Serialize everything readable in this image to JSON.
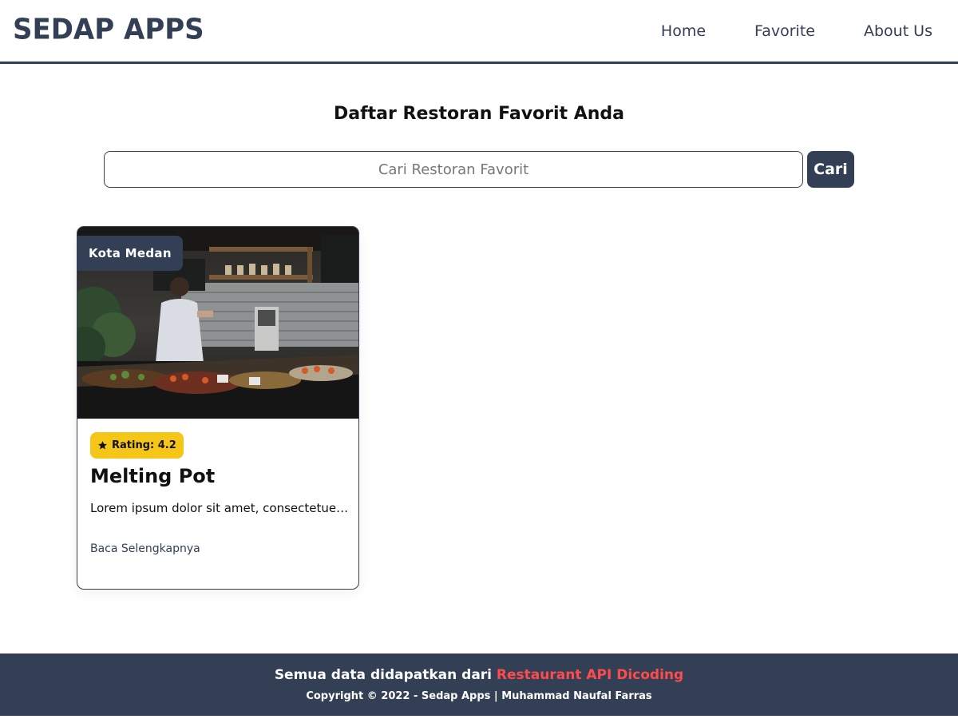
{
  "header": {
    "brand": "SEDAP APPS",
    "nav": [
      "Home",
      "Favorite",
      "About Us"
    ]
  },
  "main": {
    "title": "Daftar Restoran Favorit Anda",
    "search": {
      "placeholder": "Cari Restoran Favorit",
      "value": "",
      "button_label": "Cari"
    },
    "restaurants": [
      {
        "city": "Kota Medan",
        "rating_label": "Rating: 4.2",
        "name": "Melting Pot",
        "description": "Lorem ipsum dolor sit amet, consectetuer adipiscing elit.",
        "link_label": "Baca Selengkapnya",
        "image": "restaurant-kitchen-photo"
      }
    ]
  },
  "footer": {
    "text": "Semua data didapatkan dari ",
    "link_label": "Restaurant API Dicoding",
    "copyright": "Copyright © 2022 - Sedap Apps | Muhammad Naufal Farras"
  },
  "colors": {
    "primary": "#323f55",
    "rating": "#f5c518",
    "footer_link": "#ff4b4b"
  }
}
